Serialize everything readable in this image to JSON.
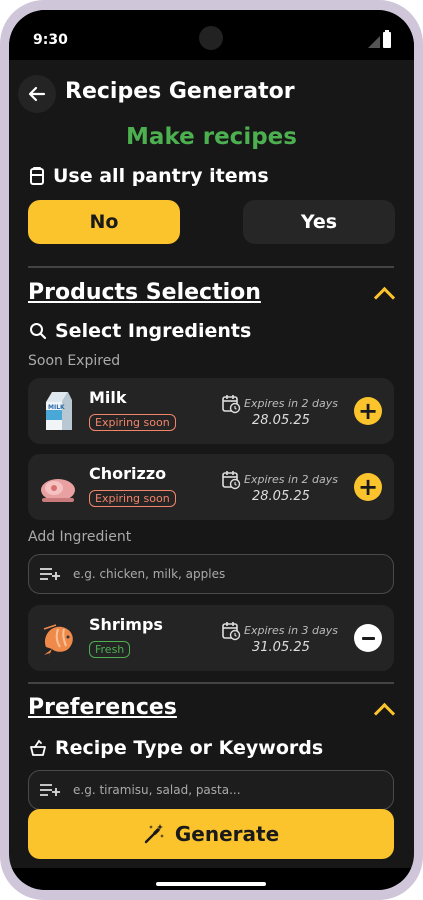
{
  "status": {
    "time": "9:30"
  },
  "header": {
    "title": "Recipes Generator"
  },
  "make_recipes": "Make recipes",
  "pantry": {
    "label": "Use all pantry items",
    "no": "No",
    "yes": "Yes",
    "selected": "No"
  },
  "products": {
    "title": "Products Selection",
    "select_label": "Select Ingredients",
    "soon_expired": "Soon Expired",
    "items": [
      {
        "name": "Milk",
        "badge": "Expiring soon",
        "expires": "Expires in 2 days",
        "date": "28.05.25",
        "action": "add"
      },
      {
        "name": "Chorizzo",
        "badge": "Expiring soon",
        "expires": "Expires in 2 days",
        "date": "28.05.25",
        "action": "add"
      }
    ],
    "add_label": "Add Ingredient",
    "add_placeholder": "e.g. chicken, milk, apples",
    "selected": [
      {
        "name": "Shrimps",
        "badge": "Fresh",
        "expires": "Expires in 3 days",
        "date": "31.05.25",
        "action": "remove"
      }
    ]
  },
  "preferences": {
    "title": "Preferences",
    "type_label": "Recipe Type or Keywords",
    "placeholder": "e.g. tiramisu, salad, pasta..."
  },
  "generate_label": "Generate",
  "colors": {
    "accent": "#fbc42d",
    "green": "#4caf50",
    "background": "#171717",
    "card": "#242424",
    "expiring": "#f2846a"
  }
}
